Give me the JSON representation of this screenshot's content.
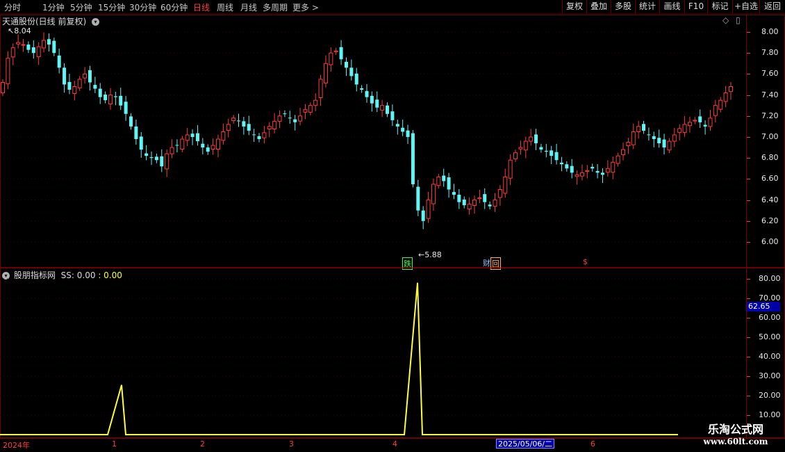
{
  "toolbar": {
    "periods": [
      "分时",
      "1分钟",
      "5分钟",
      "15分钟",
      "30分钟",
      "60分钟",
      "日线",
      "周线",
      "月线",
      "多周期",
      "更多 >"
    ],
    "active_period": "日线",
    "buttons": [
      "复权",
      "叠加",
      "多股",
      "统计",
      "画线",
      "F10",
      "标记",
      "+自选",
      "返回"
    ]
  },
  "main_pane": {
    "title": "天通股份(日线 前复权)",
    "high_marker": "8.04",
    "low_marker": "5.88",
    "y_ticks": [
      "8.00",
      "7.80",
      "7.60",
      "7.40",
      "7.20",
      "7.00",
      "6.80",
      "6.60",
      "6.40",
      "6.20",
      "6.00"
    ],
    "flags": [
      {
        "text": "跌",
        "color": "#3dff3d"
      },
      {
        "text": "财",
        "color": "#8fc3ff"
      },
      {
        "text": "回",
        "color": "#ffb060"
      },
      {
        "text": "$",
        "color": "#ff3b3b"
      }
    ],
    "colors": {
      "up": "#ff3b3b",
      "down": "#5ff5f5"
    }
  },
  "indicator_pane": {
    "title": "股朋指标网",
    "series_label": "SS: 0.00",
    "series_value": ": 0.00",
    "current_value_badge": "62.65",
    "y_ticks": [
      "80.00",
      "70.00",
      "60.00",
      "50.00",
      "40.00",
      "30.00",
      "20.00",
      "10.00"
    ],
    "line_color": "#ffff33"
  },
  "time_axis": {
    "labels": [
      "2024年",
      "1",
      "2",
      "3",
      "4",
      "6"
    ],
    "cursor_date": "2025/05/06/二"
  },
  "watermark": {
    "title": "乐淘公式网",
    "url": "www.60lt.com"
  },
  "chart_data": [
    {
      "type": "candlestick",
      "title": "天通股份(日线 前复权)",
      "ylim": [
        5.8,
        8.1
      ],
      "y_ticks": [
        8.0,
        7.8,
        7.6,
        7.4,
        7.2,
        7.0,
        6.8,
        6.6,
        6.4,
        6.2,
        6.0
      ],
      "annotated_high": 8.04,
      "annotated_low": 5.88,
      "close_series_approx": [
        7.52,
        7.75,
        7.85,
        7.9,
        7.88,
        7.83,
        7.8,
        7.86,
        7.92,
        7.88,
        7.8,
        7.66,
        7.5,
        7.45,
        7.48,
        7.55,
        7.6,
        7.52,
        7.46,
        7.38,
        7.35,
        7.4,
        7.38,
        7.3,
        7.22,
        7.1,
        6.98,
        6.88,
        6.82,
        6.8,
        6.78,
        6.72,
        6.84,
        6.9,
        6.92,
        6.98,
        7.02,
        7.0,
        6.96,
        6.9,
        6.86,
        6.92,
        6.98,
        7.05,
        7.12,
        7.18,
        7.15,
        7.1,
        7.06,
        7.02,
        6.98,
        7.04,
        7.1,
        7.15,
        7.2,
        7.22,
        7.18,
        7.14,
        7.2,
        7.26,
        7.3,
        7.35,
        7.55,
        7.7,
        7.8,
        7.82,
        7.74,
        7.66,
        7.58,
        7.5,
        7.45,
        7.38,
        7.32,
        7.28,
        7.3,
        7.22,
        7.16,
        7.1,
        7.05,
        7.0,
        6.55,
        6.3,
        6.2,
        6.4,
        6.55,
        6.62,
        6.58,
        6.5,
        6.45,
        6.38,
        6.35,
        6.36,
        6.4,
        6.42,
        6.38,
        6.34,
        6.4,
        6.5,
        6.62,
        6.78,
        6.85,
        6.9,
        6.96,
        7.0,
        6.94,
        6.88,
        6.86,
        6.82,
        6.78,
        6.74,
        6.7,
        6.66,
        6.64,
        6.66,
        6.68,
        6.7,
        6.66,
        6.64,
        6.7,
        6.76,
        6.82,
        6.88,
        6.95,
        7.05,
        7.1,
        7.06,
        7.02,
        6.98,
        6.94,
        6.9,
        6.96,
        7.02,
        7.08,
        7.12,
        7.14,
        7.16,
        7.14,
        7.1,
        7.18,
        7.3,
        7.35,
        7.42,
        7.48
      ]
    },
    {
      "type": "line",
      "series": [
        {
          "name": "SS",
          "values_approx": [
            0,
            25.5,
            0,
            0,
            78,
            0,
            0
          ]
        }
      ],
      "ylim": [
        0,
        85
      ],
      "y_ticks": [
        80,
        70,
        60,
        50,
        40,
        30,
        20,
        10
      ]
    }
  ]
}
